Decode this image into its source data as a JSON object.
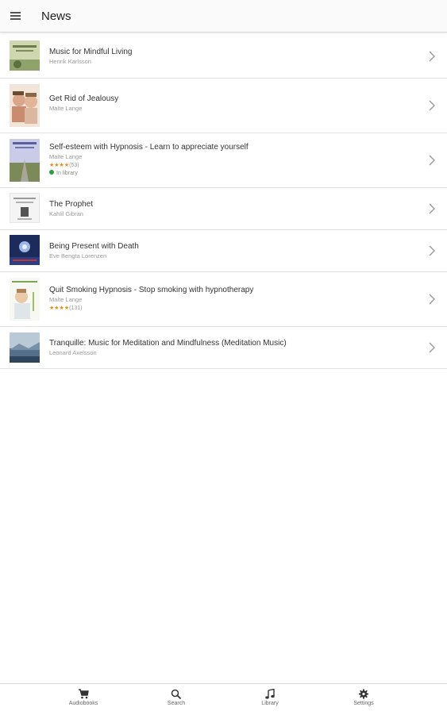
{
  "appbar": {
    "title": "News",
    "menu_icon": "hamburger-menu-icon"
  },
  "items": [
    {
      "title": "Music for Mindful Living",
      "author": "Henrik Karlsson"
    },
    {
      "title": "Get Rid of Jealousy",
      "author": "Malte Lange"
    },
    {
      "title": "Self-esteem with Hypnosis - Learn to appreciate yourself",
      "author": "Malte Lange",
      "rating": "★★★★",
      "rating_count": "(53)",
      "badge": "In library"
    },
    {
      "title": "The Prophet",
      "author": "Kahlil Gibran"
    },
    {
      "title": "Being Present with Death",
      "author": "Eve Bengta Lorenzen"
    },
    {
      "title": "Quit Smoking Hypnosis - Stop smoking with hypnotherapy",
      "author": "Malte Lange",
      "rating": "★★★★",
      "rating_count": "(131)"
    },
    {
      "title": "Tranquille: Music for Meditation and Mindfulness (Meditation Music)",
      "author": "Leonard Axelsson"
    }
  ],
  "bottom_nav": [
    {
      "label": "Audiobooks",
      "icon": "cart-icon"
    },
    {
      "label": "Search",
      "icon": "search-icon"
    },
    {
      "label": "Library",
      "icon": "music-note-icon"
    },
    {
      "label": "Settings",
      "icon": "gear-icon"
    }
  ],
  "colors": {
    "rating": "#e88a1a",
    "in_library_dot": "#2e9d3a",
    "divider": "#e2e2e2"
  }
}
